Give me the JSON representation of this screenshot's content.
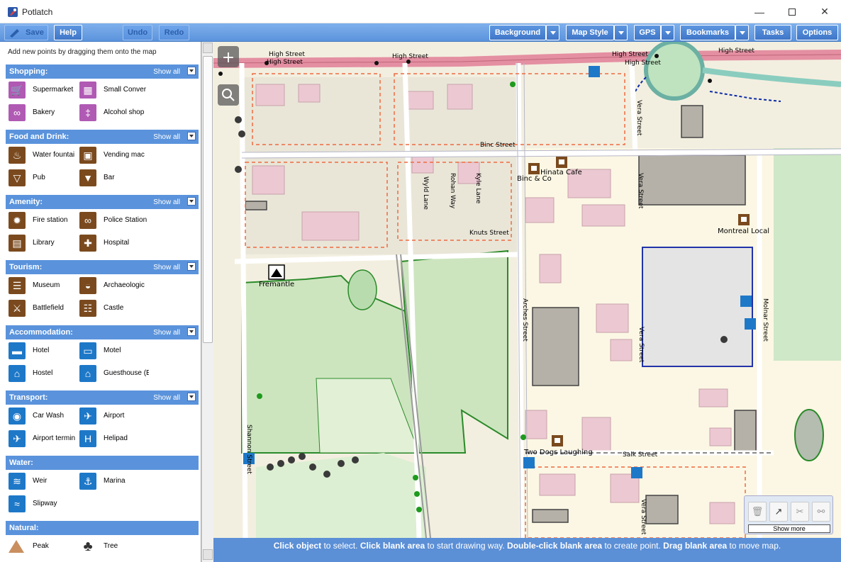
{
  "window": {
    "title": "Potlatch"
  },
  "toolbar": {
    "save": "Save",
    "help": "Help",
    "undo": "Undo",
    "redo": "Redo",
    "background": "Background",
    "map_style": "Map Style",
    "gps": "GPS",
    "bookmarks": "Bookmarks",
    "tasks": "Tasks",
    "options": "Options"
  },
  "sidebar": {
    "hint": "Add new points by dragging them onto the map",
    "show_all": "Show all",
    "sections": [
      {
        "name": "Shopping:",
        "items": [
          {
            "label": "Supermarket",
            "icon": "shopping-cart-icon"
          },
          {
            "label": "Small Conver",
            "icon": "basket-icon"
          },
          {
            "label": "Bakery",
            "icon": "pretzel-icon"
          },
          {
            "label": "Alcohol shop",
            "icon": "bottle-icon"
          }
        ]
      },
      {
        "name": "Food and Drink:",
        "items": [
          {
            "label": "Water fountai",
            "icon": "water-tap-icon"
          },
          {
            "label": "Vending mac",
            "icon": "vending-machine-icon"
          },
          {
            "label": "Pub",
            "icon": "beer-glass-icon"
          },
          {
            "label": "Bar",
            "icon": "cocktail-icon"
          }
        ]
      },
      {
        "name": "Amenity:",
        "items": [
          {
            "label": "Fire station",
            "icon": "fire-icon"
          },
          {
            "label": "Police Station",
            "icon": "handcuffs-icon"
          },
          {
            "label": "Library",
            "icon": "book-icon"
          },
          {
            "label": "Hospital",
            "icon": "hospital-cross-icon"
          }
        ]
      },
      {
        "name": "Tourism:",
        "items": [
          {
            "label": "Museum",
            "icon": "museum-icon"
          },
          {
            "label": "Archaeologic",
            "icon": "urn-icon"
          },
          {
            "label": "Battlefield",
            "icon": "crossed-swords-icon"
          },
          {
            "label": "Castle",
            "icon": "castle-icon"
          }
        ]
      },
      {
        "name": "Accommodation:",
        "items": [
          {
            "label": "Hotel",
            "icon": "hotel-bed-icon"
          },
          {
            "label": "Motel",
            "icon": "motel-icon"
          },
          {
            "label": "Hostel",
            "icon": "hostel-icon"
          },
          {
            "label": "Guesthouse (E",
            "icon": "guesthouse-icon"
          }
        ]
      },
      {
        "name": "Transport:",
        "items": [
          {
            "label": "Car Wash",
            "icon": "car-wash-icon"
          },
          {
            "label": "Airport",
            "icon": "airplane-icon"
          },
          {
            "label": "Airport termin",
            "icon": "airport-terminal-icon"
          },
          {
            "label": "Helipad",
            "icon": "helipad-icon"
          }
        ]
      },
      {
        "name": "Water:",
        "items": [
          {
            "label": "Weir",
            "icon": "weir-icon"
          },
          {
            "label": "Marina",
            "icon": "anchor-icon"
          },
          {
            "label": "Slipway",
            "icon": "slipway-icon"
          }
        ]
      },
      {
        "name": "Natural:",
        "items": [
          {
            "label": "Peak",
            "icon": "peak-triangle-icon"
          },
          {
            "label": "Tree",
            "icon": "tree-icon"
          }
        ]
      }
    ]
  },
  "map": {
    "streets": [
      "High Street",
      "High Street",
      "High Street",
      "High Street",
      "High Street",
      "High Street",
      "Binc Street",
      "Vera Street",
      "Vera Street",
      "Vera Street",
      "Vera Street",
      "Wyld Lane",
      "Rohan Way",
      "Kyle Lane",
      "Knuts Street",
      "Arches Street",
      "Molnar Street",
      "Salk Street",
      "Shannon Street"
    ],
    "places": [
      "Hinata Cafe",
      "Binc & Co",
      "Montreal Local",
      "Fremantle",
      "Two Dogs Laughing"
    ],
    "colors": {
      "accent": "#5a93dc",
      "statusbar": "#5b8fd6",
      "poi_brown": "#7a4a1e",
      "poi_blue": "#1e78c8",
      "poi_purple": "#b05ab4"
    }
  },
  "palette": {
    "show_more": "Show more"
  },
  "status": {
    "p1b": "Click object",
    "p1": " to select. ",
    "p2b": "Click blank area",
    "p2": " to start drawing way. ",
    "p3b": "Double-click blank area",
    "p3": " to create point. ",
    "p4b": "Drag blank area",
    "p4": " to move map."
  }
}
